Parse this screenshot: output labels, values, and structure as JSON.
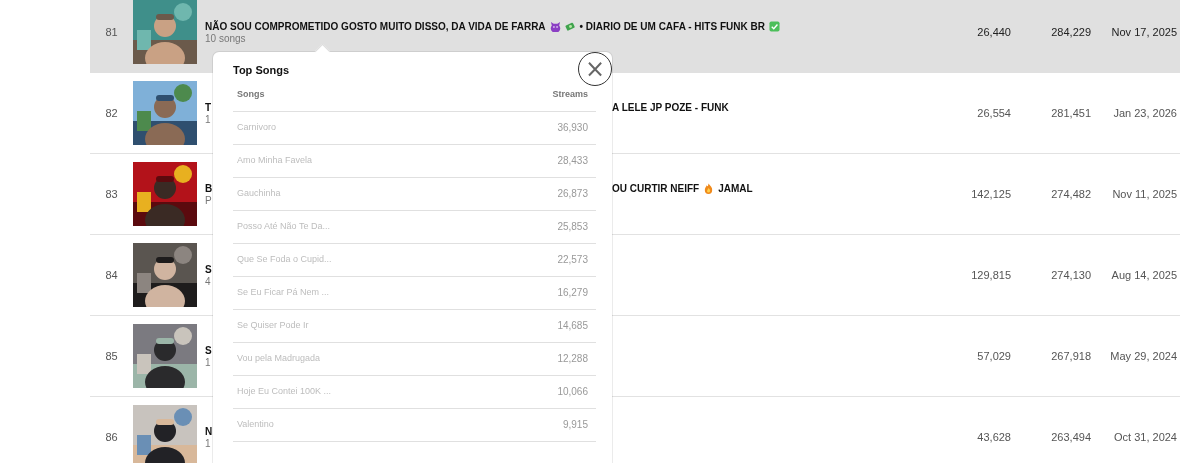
{
  "rows": [
    {
      "rank": "81",
      "highlighted": true,
      "title_parts": [
        {
          "kind": "text",
          "text": "NÃO SOU COMPROMETIDO GOSTO MUITO DISSO, DA VIDA DE FARRA"
        },
        {
          "kind": "devil"
        },
        {
          "kind": "money"
        },
        {
          "kind": "text",
          "text": "• DIARIO DE UM CAFA - HITS FUNK BR"
        },
        {
          "kind": "check"
        }
      ],
      "subtitle": "10 songs",
      "col_1": "26,440",
      "col_2": "284,229",
      "date": "Nov 17, 2025"
    },
    {
      "rank": "82",
      "highlighted": false,
      "title_start": "T",
      "title_end_parts": [
        {
          "kind": "text",
          "text": "A LELE JP POZE - FUNK"
        }
      ],
      "subtitle": "1",
      "col_1": "26,554",
      "col_2": "281,451",
      "date": "Jan 23, 2026"
    },
    {
      "rank": "83",
      "highlighted": false,
      "title_start": "B",
      "title_end_parts": [
        {
          "kind": "text",
          "text": "OU CURTIR NEIFF"
        },
        {
          "kind": "fire"
        },
        {
          "kind": "text",
          "text": "JAMAL"
        }
      ],
      "subtitle": "P",
      "col_1": "142,125",
      "col_2": "274,482",
      "date": "Nov 11, 2025"
    },
    {
      "rank": "84",
      "highlighted": false,
      "title_start": "S",
      "title_end_parts": [],
      "subtitle": "4",
      "col_1": "129,815",
      "col_2": "274,130",
      "date": "Aug 14, 2025"
    },
    {
      "rank": "85",
      "highlighted": false,
      "title_start": "S",
      "title_end_parts": [],
      "subtitle": "1",
      "col_1": "57,029",
      "col_2": "267,918",
      "date": "May 29, 2024"
    },
    {
      "rank": "86",
      "highlighted": false,
      "title_start": "N",
      "title_end_parts": [],
      "subtitle": "1",
      "col_1": "43,628",
      "col_2": "263,494",
      "date": "Oct 31, 2024"
    }
  ],
  "popover": {
    "title": "Top Songs",
    "close": "×",
    "columns": [
      "Songs",
      "Streams"
    ],
    "songs": [
      {
        "name": "Carnivoro",
        "streams": "36,930"
      },
      {
        "name": "Amo Minha Favela",
        "streams": "28,433"
      },
      {
        "name": "Gauchinha",
        "streams": "26,873"
      },
      {
        "name": "Posso Até Não Te Da...",
        "streams": "25,853"
      },
      {
        "name": "Que Se Foda o Cupid...",
        "streams": "22,573"
      },
      {
        "name": "Se Eu Ficar Pá Nem ...",
        "streams": "16,279"
      },
      {
        "name": "Se Quiser Pode Ir",
        "streams": "14,685"
      },
      {
        "name": "Vou pela Madrugada",
        "streams": "12,288"
      },
      {
        "name": "Hoje Eu Contei 100K ...",
        "streams": "10,066"
      },
      {
        "name": "Valentino",
        "streams": "9,915"
      }
    ]
  }
}
